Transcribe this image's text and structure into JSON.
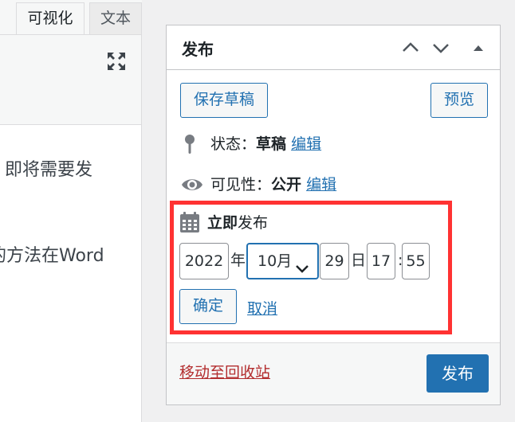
{
  "editor": {
    "tabs": [
      {
        "label": "可视化",
        "active": true
      },
      {
        "label": "文本",
        "active": false
      }
    ],
    "toolbar": {
      "fullscreen_icon": "fullscreen-icon"
    },
    "content_lines": [
      "即将需要发",
      "的方法在Word"
    ]
  },
  "publish_box": {
    "title": "发布",
    "header_icons": [
      "chevron-up-icon",
      "chevron-down-icon",
      "triangle-up-icon"
    ],
    "save_draft_label": "保存草稿",
    "preview_label": "预览",
    "status": {
      "icon": "pin-icon",
      "label": "状态：",
      "value": "草稿",
      "edit_label": "编辑"
    },
    "visibility": {
      "icon": "eye-icon",
      "label": "可见性：",
      "value": "公开",
      "edit_label": "编辑"
    },
    "schedule": {
      "icon": "calendar-icon",
      "label_strong": "立即",
      "label_rest": "发布",
      "year": "2022",
      "year_unit": "年",
      "month": "10月",
      "day": "29",
      "day_unit": "日",
      "hour": "17",
      "time_sep": ":",
      "minute": "55",
      "ok_label": "确定",
      "cancel_label": "取消",
      "highlight_color": "#ff3232"
    },
    "trash_label": "移动至回收站",
    "publish_label": "发布"
  },
  "colors": {
    "accent": "#2271b1",
    "danger": "#b32d2e",
    "background": "#f0f0f1"
  }
}
